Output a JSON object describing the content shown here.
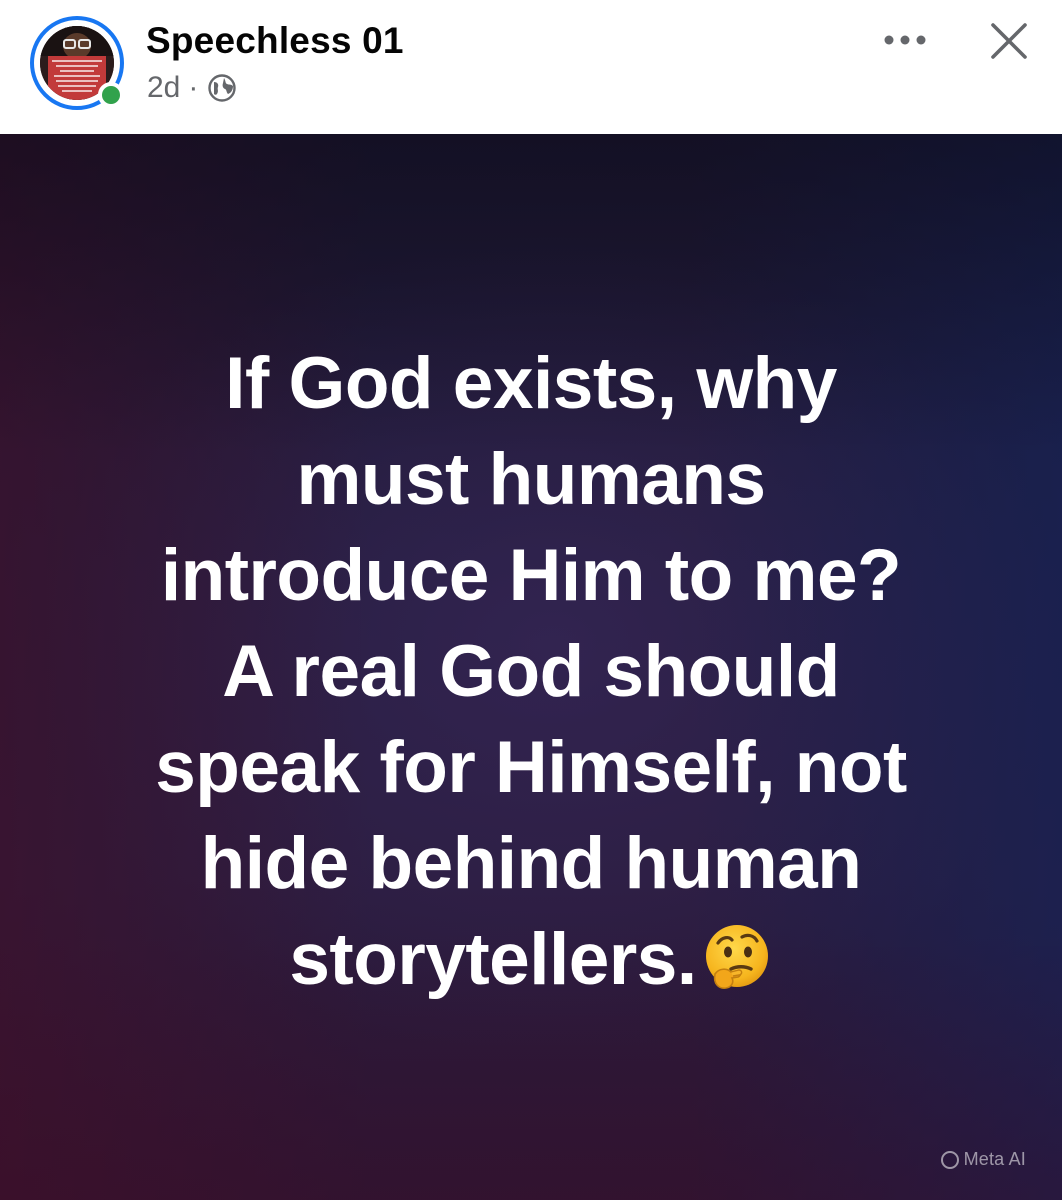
{
  "header": {
    "author_name": "Speechless 01",
    "timestamp": "2d",
    "separator": "·",
    "audience_icon": "globe-icon",
    "online_status": "online",
    "online_color": "#31a24c",
    "ring_color": "#1877f2",
    "more_icon": "more-options-icon",
    "close_icon": "close-icon"
  },
  "post": {
    "lines": [
      "If God exists, why",
      "must humans",
      "introduce Him to me?",
      "A real God should",
      "speak for Himself, not",
      "hide behind human",
      "storytellers."
    ],
    "emoji": "thinking-face-icon",
    "text_color": "#ffffff",
    "background_colors": [
      "#1d1833",
      "#2a1c3e",
      "#3a1230",
      "#16245a"
    ]
  },
  "watermark": {
    "label": "Meta AI",
    "icon": "meta-ai-icon"
  }
}
